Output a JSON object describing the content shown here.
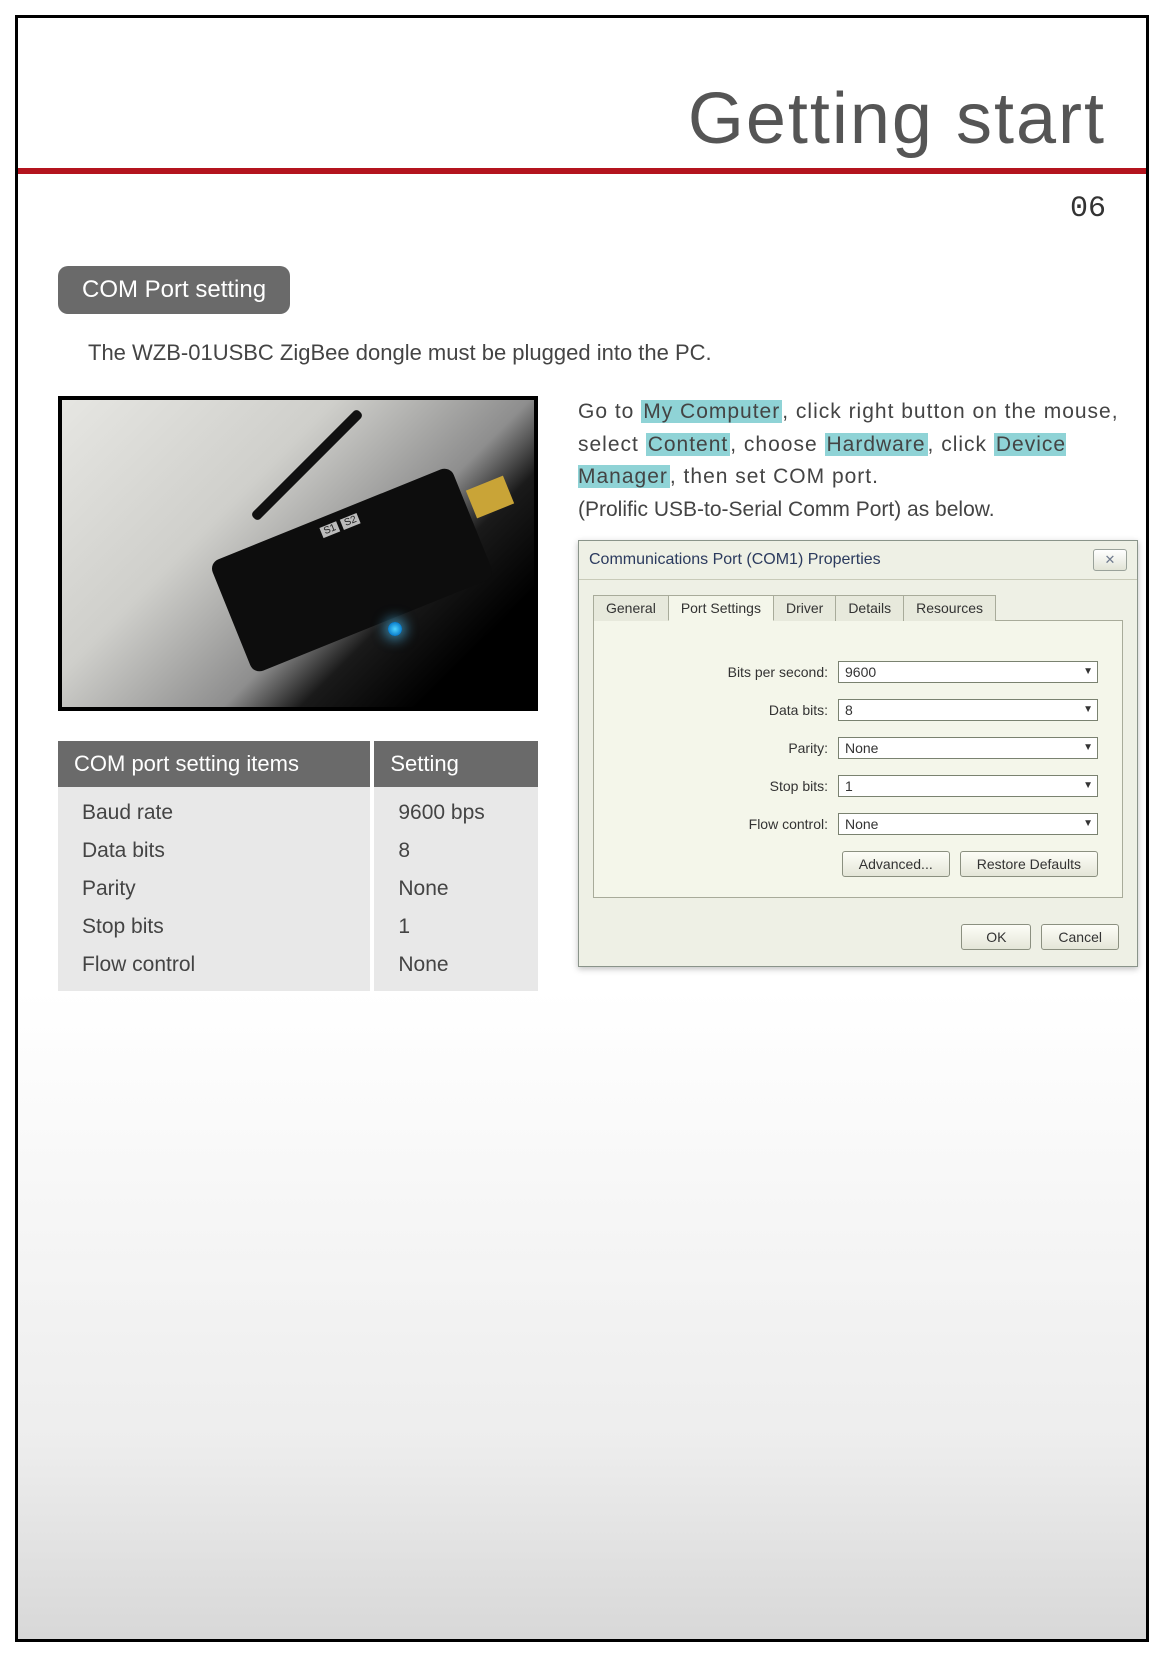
{
  "header": {
    "title": "Getting start",
    "page_number": "06"
  },
  "section": {
    "label": "COM Port setting",
    "intro": "The WZB-01USBC ZigBee dongle  must be plugged into the PC."
  },
  "photo": {
    "s1": "S1",
    "s2": "S2"
  },
  "settings_table": {
    "col1_header": "COM port setting items",
    "col2_header": "Setting",
    "rows": [
      {
        "item": "Baud rate",
        "value": "9600 bps"
      },
      {
        "item": "Data bits",
        "value": "8"
      },
      {
        "item": "Parity",
        "value": "None"
      },
      {
        "item": "Stop bits",
        "value": "1"
      },
      {
        "item": "Flow control",
        "value": "None"
      }
    ]
  },
  "instructions": {
    "pre1": "Go to ",
    "hl1": "My Computer",
    "mid1": ", click right button on the mouse, select ",
    "hl2": "Content",
    "mid2": ", choose ",
    "hl3": "Hardware",
    "mid3": ", click ",
    "hl4": "Device Manager",
    "post": ", then set COM port.",
    "subnote": "(Prolific USB-to-Serial Comm Port) as below."
  },
  "dialog": {
    "title": "Communications Port (COM1) Properties",
    "close_glyph": "✕",
    "tabs": {
      "general": "General",
      "port_settings": "Port Settings",
      "driver": "Driver",
      "details": "Details",
      "resources": "Resources"
    },
    "fields": {
      "bps": {
        "label": "Bits per second:",
        "value": "9600"
      },
      "data": {
        "label": "Data bits:",
        "value": "8"
      },
      "parity": {
        "label": "Parity:",
        "value": "None"
      },
      "stop": {
        "label": "Stop bits:",
        "value": "1"
      },
      "flow": {
        "label": "Flow control:",
        "value": "None"
      }
    },
    "buttons": {
      "advanced": "Advanced...",
      "restore": "Restore Defaults",
      "ok": "OK",
      "cancel": "Cancel"
    }
  }
}
